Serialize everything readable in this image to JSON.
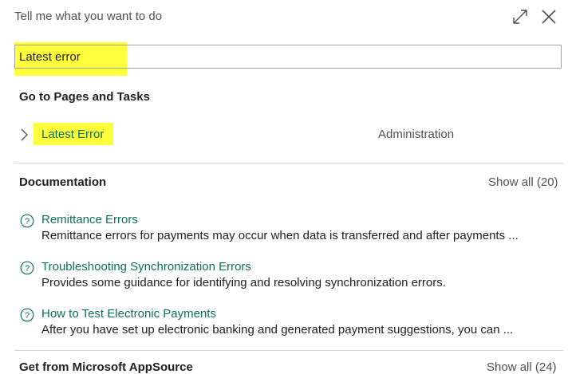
{
  "dialog": {
    "title": "Tell me what you want to do"
  },
  "search": {
    "value": "Latest error",
    "placeholder": ""
  },
  "pages_section": {
    "heading": "Go to Pages and Tasks",
    "results": [
      {
        "label": "Latest Error",
        "category": "Administration"
      }
    ]
  },
  "documentation": {
    "heading": "Documentation",
    "show_all": "Show all (20)",
    "items": [
      {
        "title": "Remittance Errors",
        "description": "Remittance errors for payments may occur when data is transferred and after payments ..."
      },
      {
        "title": "Troubleshooting Synchronization Errors",
        "description": "Provides some guidance for identifying and resolving synchronization errors."
      },
      {
        "title": "How to Test Electronic Payments",
        "description": "After you have set up electronic banking and generated payment suggestions, you can ..."
      }
    ]
  },
  "next_section": {
    "heading": "Get from Microsoft AppSource",
    "show_all": "Show all (24)"
  },
  "colors": {
    "highlight": "#ffff3b",
    "link": "#0d6e5e",
    "divider": "#d6d6d6"
  }
}
